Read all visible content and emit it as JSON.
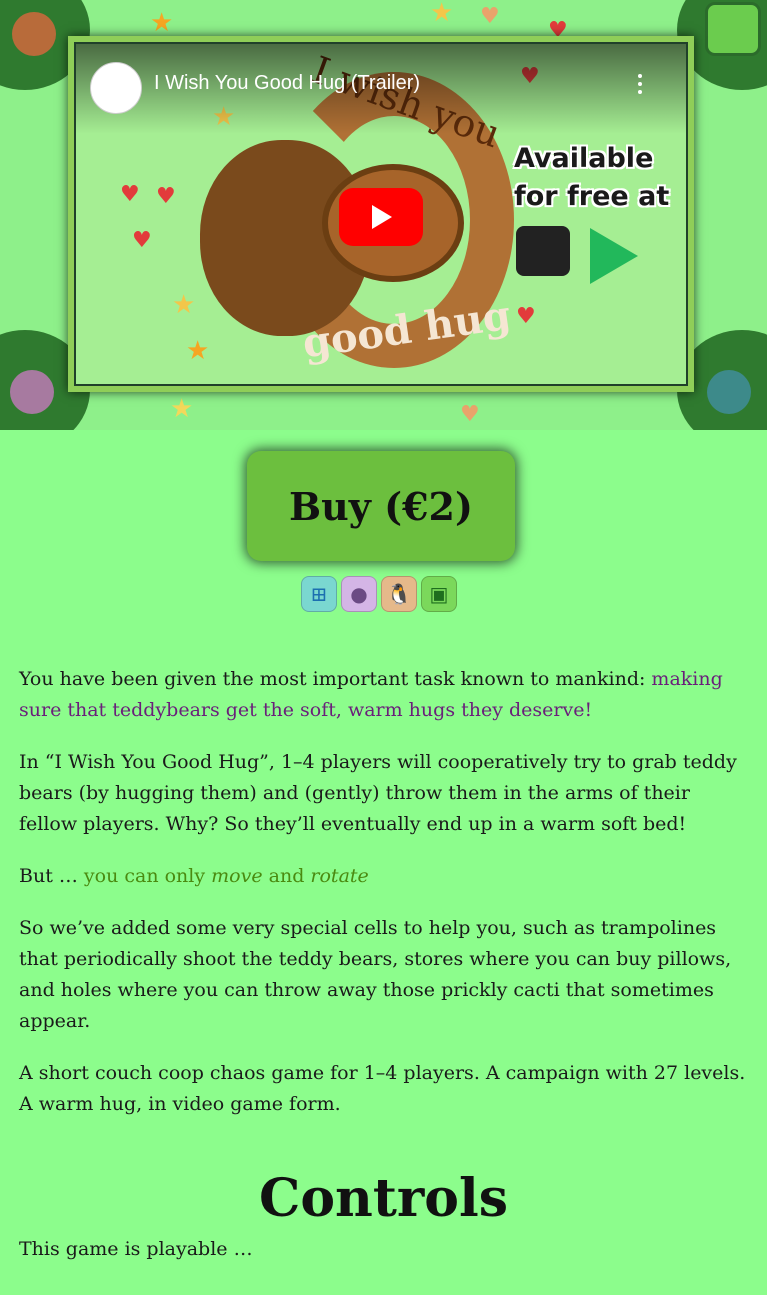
{
  "video": {
    "title": "I Wish You Good Hug (Trailer)",
    "thumbnail_text_top": "I wish you",
    "thumbnail_text_bottom": "good hug",
    "available_line1": "Available",
    "available_line2": "for free at",
    "icons": [
      "panda-channel-avatar",
      "more-options-icon",
      "youtube-play-icon",
      "itch-io-icon",
      "google-play-icon"
    ]
  },
  "buy_button": {
    "label": "Buy (€2)"
  },
  "platforms": [
    {
      "name": "windows",
      "glyph": "⊞"
    },
    {
      "name": "apple",
      "glyph": "●"
    },
    {
      "name": "linux",
      "glyph": "🐧"
    },
    {
      "name": "android",
      "glyph": "▣"
    }
  ],
  "description": {
    "p1_a": "You have been given the most important task known to mankind: ",
    "p1_b": "making sure that teddybears get the soft, warm hugs they deserve!",
    "p2": "In “I Wish You Good Hug”, 1–4 players will cooperatively try to grab teddy bears (by hugging them) and (gently) throw them in the arms of their fellow players. Why? So they’ll eventually end up in a warm soft bed!",
    "p3_a": "But … ",
    "p3_b": "you can only ",
    "p3_c": "move",
    "p3_d": " and ",
    "p3_e": "rotate",
    "p4": "So we’ve added some very special cells to help you, such as trampolines that periodically shoot the teddy bears, stores where you can buy pillows, and holes where you can throw away those prickly cacti that sometimes appear.",
    "p5": "A short couch coop chaos game for 1–4 players. A campaign with 27 levels. A warm hug, in video game form."
  },
  "controls": {
    "heading": "Controls",
    "intro": "This game is playable …"
  },
  "colors": {
    "page_bg": "#8cfd8c",
    "buy_bg": "#6cbf3e",
    "purple_text": "#6a1f7a",
    "olive_text": "#4a8a10"
  }
}
